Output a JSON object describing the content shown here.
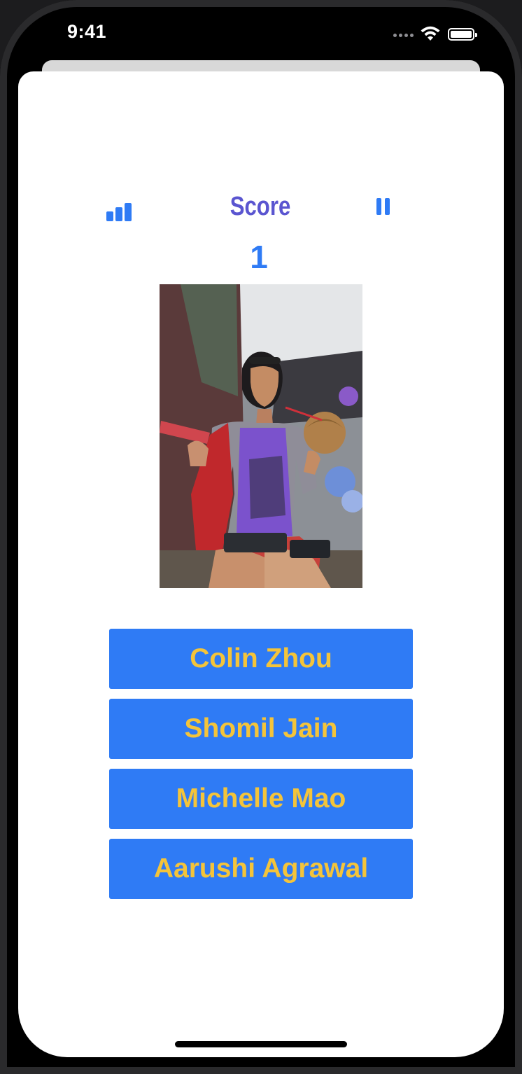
{
  "status_bar": {
    "time": "9:41",
    "signal_icon": "signal-dots-icon",
    "wifi_icon": "wifi-icon",
    "battery_icon": "battery-icon"
  },
  "header": {
    "stats_icon": "bar-chart-icon",
    "score_label": "Score",
    "pause_icon": "pause-icon",
    "score_value": "1"
  },
  "photo": {
    "description_icon": "portrait-photo"
  },
  "answers": [
    {
      "label": "Colin Zhou"
    },
    {
      "label": "Shomil Jain"
    },
    {
      "label": "Michelle Mao"
    },
    {
      "label": "Aarushi Agrawal"
    }
  ],
  "colors": {
    "accent_blue": "#2f7bf5",
    "score_label_purple": "#5a55d0",
    "answer_text_yellow": "#f4c43a"
  }
}
